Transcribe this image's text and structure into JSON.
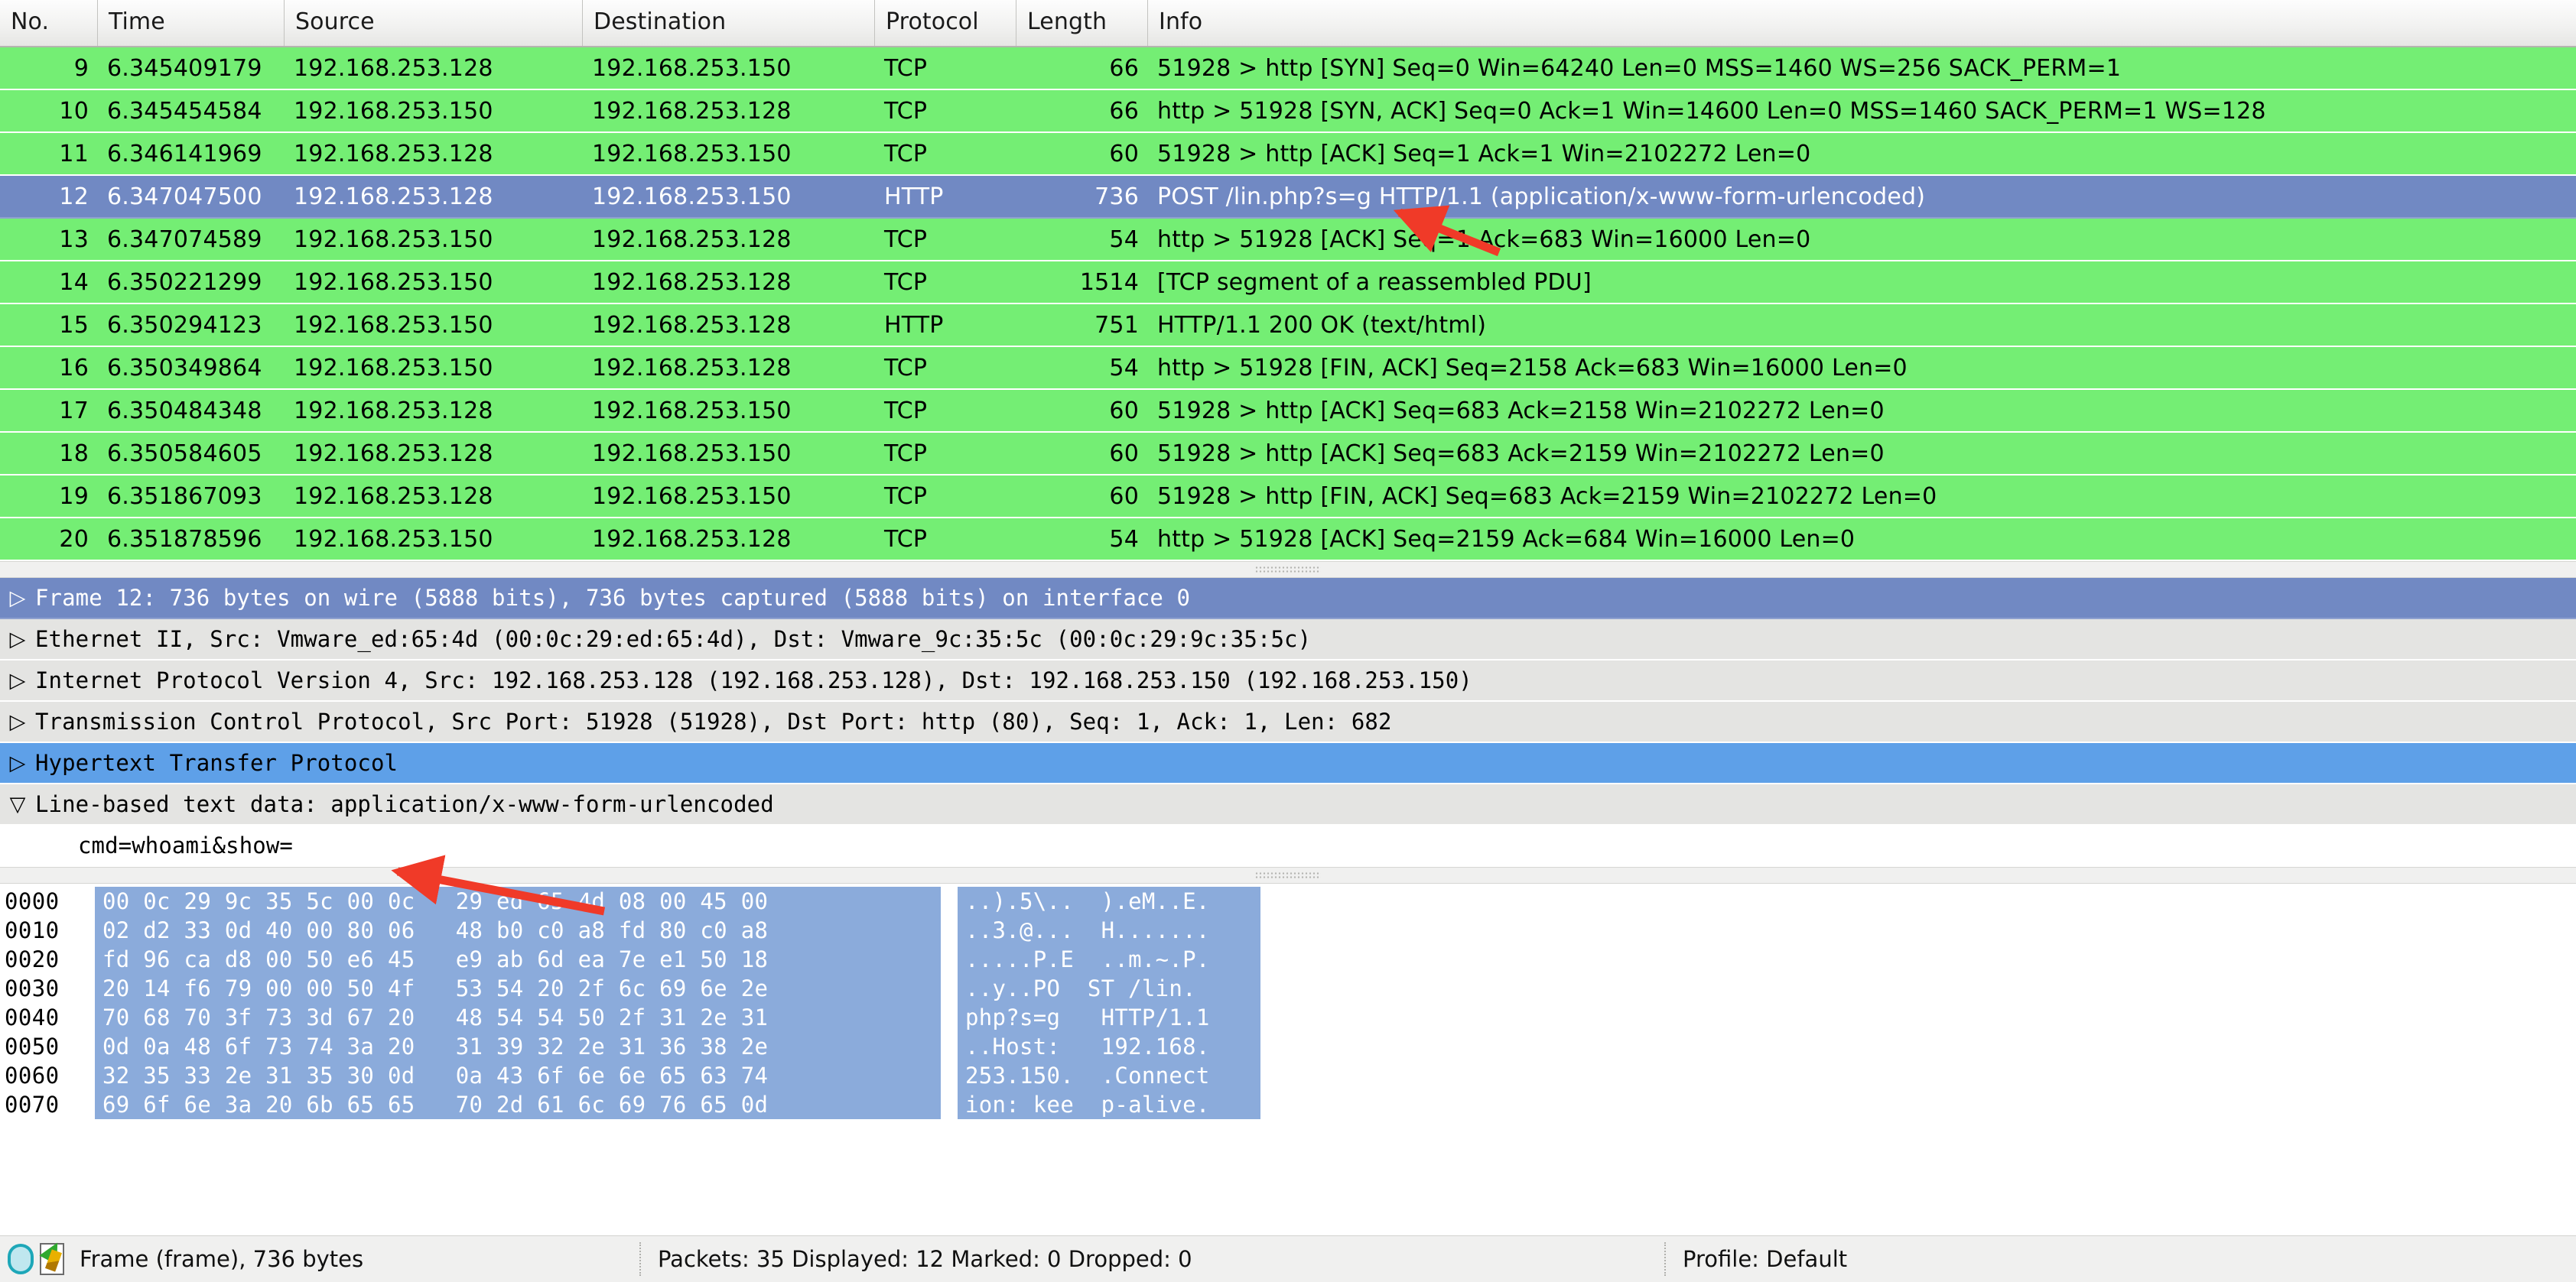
{
  "packet_list": {
    "columns": [
      {
        "key": "no",
        "label": "No."
      },
      {
        "key": "time",
        "label": "Time"
      },
      {
        "key": "source",
        "label": "Source"
      },
      {
        "key": "destination",
        "label": "Destination"
      },
      {
        "key": "protocol",
        "label": "Protocol"
      },
      {
        "key": "length",
        "label": "Length"
      },
      {
        "key": "info",
        "label": "Info"
      }
    ],
    "rows": [
      {
        "no": "9",
        "time": "6.345409179",
        "source": "192.168.253.128",
        "destination": "192.168.253.150",
        "protocol": "TCP",
        "length": "66",
        "info": "51928 > http [SYN] Seq=0 Win=64240 Len=0 MSS=1460 WS=256 SACK_PERM=1",
        "selected": false
      },
      {
        "no": "10",
        "time": "6.345454584",
        "source": "192.168.253.150",
        "destination": "192.168.253.128",
        "protocol": "TCP",
        "length": "66",
        "info": "http > 51928 [SYN, ACK] Seq=0 Ack=1 Win=14600 Len=0 MSS=1460 SACK_PERM=1 WS=128",
        "selected": false
      },
      {
        "no": "11",
        "time": "6.346141969",
        "source": "192.168.253.128",
        "destination": "192.168.253.150",
        "protocol": "TCP",
        "length": "60",
        "info": "51928 > http [ACK] Seq=1 Ack=1 Win=2102272 Len=0",
        "selected": false
      },
      {
        "no": "12",
        "time": "6.347047500",
        "source": "192.168.253.128",
        "destination": "192.168.253.150",
        "protocol": "HTTP",
        "length": "736",
        "info": "POST /lin.php?s=g HTTP/1.1  (application/x-www-form-urlencoded)",
        "selected": true
      },
      {
        "no": "13",
        "time": "6.347074589",
        "source": "192.168.253.150",
        "destination": "192.168.253.128",
        "protocol": "TCP",
        "length": "54",
        "info": "http > 51928 [ACK] Seq=1 Ack=683 Win=16000 Len=0",
        "selected": false
      },
      {
        "no": "14",
        "time": "6.350221299",
        "source": "192.168.253.150",
        "destination": "192.168.253.128",
        "protocol": "TCP",
        "length": "1514",
        "info": "[TCP segment of a reassembled PDU]",
        "selected": false
      },
      {
        "no": "15",
        "time": "6.350294123",
        "source": "192.168.253.150",
        "destination": "192.168.253.128",
        "protocol": "HTTP",
        "length": "751",
        "info": "HTTP/1.1 200 OK  (text/html)",
        "selected": false
      },
      {
        "no": "16",
        "time": "6.350349864",
        "source": "192.168.253.150",
        "destination": "192.168.253.128",
        "protocol": "TCP",
        "length": "54",
        "info": "http > 51928 [FIN, ACK] Seq=2158 Ack=683 Win=16000 Len=0",
        "selected": false
      },
      {
        "no": "17",
        "time": "6.350484348",
        "source": "192.168.253.128",
        "destination": "192.168.253.150",
        "protocol": "TCP",
        "length": "60",
        "info": "51928 > http [ACK] Seq=683 Ack=2158 Win=2102272 Len=0",
        "selected": false
      },
      {
        "no": "18",
        "time": "6.350584605",
        "source": "192.168.253.128",
        "destination": "192.168.253.150",
        "protocol": "TCP",
        "length": "60",
        "info": "51928 > http [ACK] Seq=683 Ack=2159 Win=2102272 Len=0",
        "selected": false
      },
      {
        "no": "19",
        "time": "6.351867093",
        "source": "192.168.253.128",
        "destination": "192.168.253.150",
        "protocol": "TCP",
        "length": "60",
        "info": "51928 > http [FIN, ACK] Seq=683 Ack=2159 Win=2102272 Len=0",
        "selected": false
      },
      {
        "no": "20",
        "time": "6.351878596",
        "source": "192.168.253.150",
        "destination": "192.168.253.128",
        "protocol": "TCP",
        "length": "54",
        "info": "http > 51928 [ACK] Seq=2159 Ack=684 Win=16000 Len=0",
        "selected": false
      }
    ]
  },
  "detail_tree": {
    "rows": [
      {
        "triangle": "▷",
        "text": "Frame 12: 736 bytes on wire (5888 bits), 736 bytes captured (5888 bits) on interface 0",
        "state": "collapsed",
        "style": "sel-frame"
      },
      {
        "triangle": "▷",
        "text": "Ethernet II, Src: Vmware_ed:65:4d (00:0c:29:ed:65:4d), Dst: Vmware_9c:35:5c (00:0c:29:9c:35:5c)",
        "state": "collapsed",
        "style": "normal"
      },
      {
        "triangle": "▷",
        "text": "Internet Protocol Version 4, Src: 192.168.253.128 (192.168.253.128), Dst: 192.168.253.150 (192.168.253.150)",
        "state": "collapsed",
        "style": "normal"
      },
      {
        "triangle": "▷",
        "text": "Transmission Control Protocol, Src Port: 51928 (51928), Dst Port: http (80), Seq: 1, Ack: 1, Len: 682",
        "state": "collapsed",
        "style": "normal"
      },
      {
        "triangle": "▷",
        "text": "Hypertext Transfer Protocol",
        "state": "collapsed",
        "style": "sel-http"
      },
      {
        "triangle": "▽",
        "text": "Line-based text data: application/x-www-form-urlencoded",
        "state": "expanded",
        "style": "normal"
      },
      {
        "triangle": "",
        "text": "cmd=whoami&show=",
        "state": "leaf",
        "style": "leaf"
      }
    ]
  },
  "hex_dump": {
    "rows": [
      {
        "offset": "0000",
        "bytes": "00 0c 29 9c 35 5c 00 0c   29 ed 65 4d 08 00 45 00",
        "ascii": "..).5\\..  ).eM..E."
      },
      {
        "offset": "0010",
        "bytes": "02 d2 33 0d 40 00 80 06   48 b0 c0 a8 fd 80 c0 a8",
        "ascii": "..3.@...  H......."
      },
      {
        "offset": "0020",
        "bytes": "fd 96 ca d8 00 50 e6 45   e9 ab 6d ea 7e e1 50 18",
        "ascii": ".....P.E  ..m.~.P."
      },
      {
        "offset": "0030",
        "bytes": "20 14 f6 79 00 00 50 4f   53 54 20 2f 6c 69 6e 2e",
        "ascii": "..y..PO  ST /lin."
      },
      {
        "offset": "0040",
        "bytes": "70 68 70 3f 73 3d 67 20   48 54 54 50 2f 31 2e 31",
        "ascii": "php?s=g   HTTP/1.1"
      },
      {
        "offset": "0050",
        "bytes": "0d 0a 48 6f 73 74 3a 20   31 39 32 2e 31 36 38 2e",
        "ascii": "..Host:   192.168."
      },
      {
        "offset": "0060",
        "bytes": "32 35 33 2e 31 35 30 0d   0a 43 6f 6e 6e 65 63 74",
        "ascii": "253.150.  .Connect"
      },
      {
        "offset": "0070",
        "bytes": "69 6f 6e 3a 20 6b 65 65   70 2d 61 6c 69 76 65 0d",
        "ascii": "ion: kee  p-alive."
      }
    ]
  },
  "status_bar": {
    "capture_icon": "capture-status-icon",
    "prefs_icon": "capture-file-properties-icon",
    "field_info": "Frame (frame), 736 bytes",
    "counts": "Packets: 35 Displayed: 12 Marked: 0 Dropped: 0",
    "profile": "Profile: Default"
  },
  "annotations": {
    "arrow_color": "#f03a28",
    "arrow_1_target": "POST /lin.php?s=g URI in packet 12 info column",
    "arrow_2_target": "cmd=whoami&show= line-based text data"
  },
  "colors": {
    "row_tcp_green": "#74ee74",
    "row_selected_blue": "#7189c3",
    "detail_selected_blue": "#5ea0e8",
    "hex_highlight_blue": "#8babdb",
    "chrome_gray": "#f0f0ef"
  }
}
